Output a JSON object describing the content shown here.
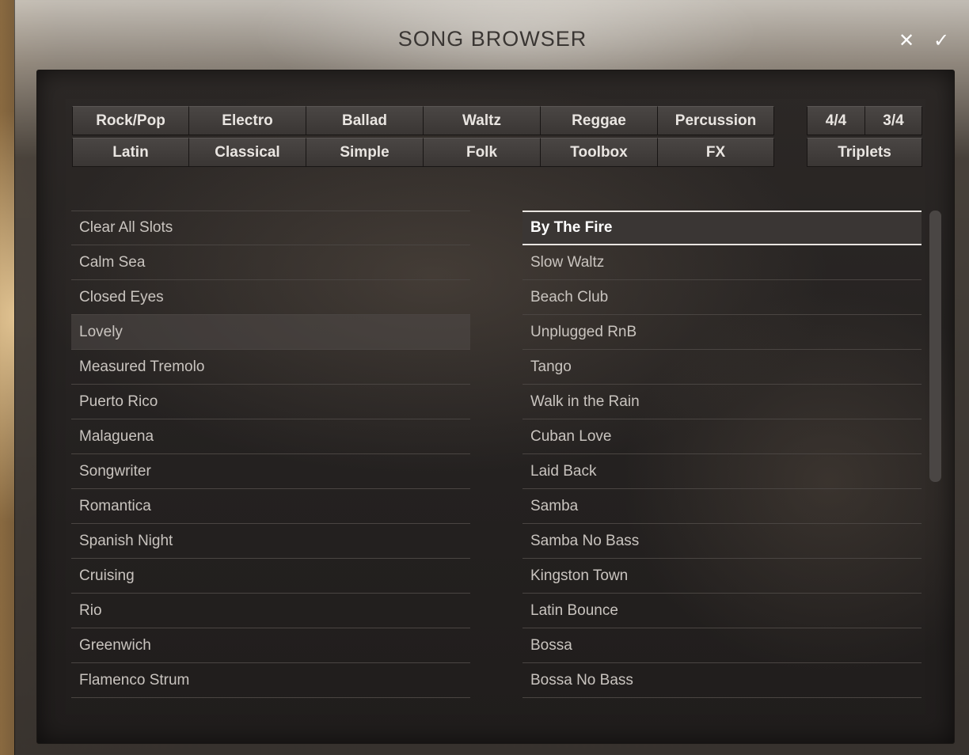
{
  "window": {
    "title": "SONG BROWSER",
    "close_glyph": "✕",
    "confirm_glyph": "✓"
  },
  "genres": {
    "row1": [
      "Rock/Pop",
      "Electro",
      "Ballad",
      "Waltz",
      "Reggae",
      "Percussion"
    ],
    "row2": [
      "Latin",
      "Classical",
      "Simple",
      "Folk",
      "Toolbox",
      "FX"
    ]
  },
  "time_signatures": {
    "four_four": "4/4",
    "three_four": "3/4",
    "triplets": "Triplets"
  },
  "left_list": [
    "Clear All Slots",
    "Calm Sea",
    "Closed Eyes",
    "Lovely",
    "Measured Tremolo",
    "Puerto Rico",
    "Malaguena",
    "Songwriter",
    "Romantica",
    "Spanish Night",
    "Cruising",
    "Rio",
    "Greenwich",
    "Flamenco Strum"
  ],
  "right_list": [
    "By The Fire",
    "Slow Waltz",
    "Beach Club",
    "Unplugged RnB",
    "Tango",
    "Walk in the Rain",
    "Cuban Love",
    "Laid Back",
    "Samba",
    "Samba No Bass",
    "Kingston Town",
    "Latin Bounce",
    "Bossa",
    "Bossa No Bass"
  ],
  "selected_right": "By The Fire",
  "highlighted_left": "Lovely",
  "colors": {
    "text": "#c9c4bf",
    "selected_text": "#ffffff",
    "button_bg": "#3f3b39"
  }
}
